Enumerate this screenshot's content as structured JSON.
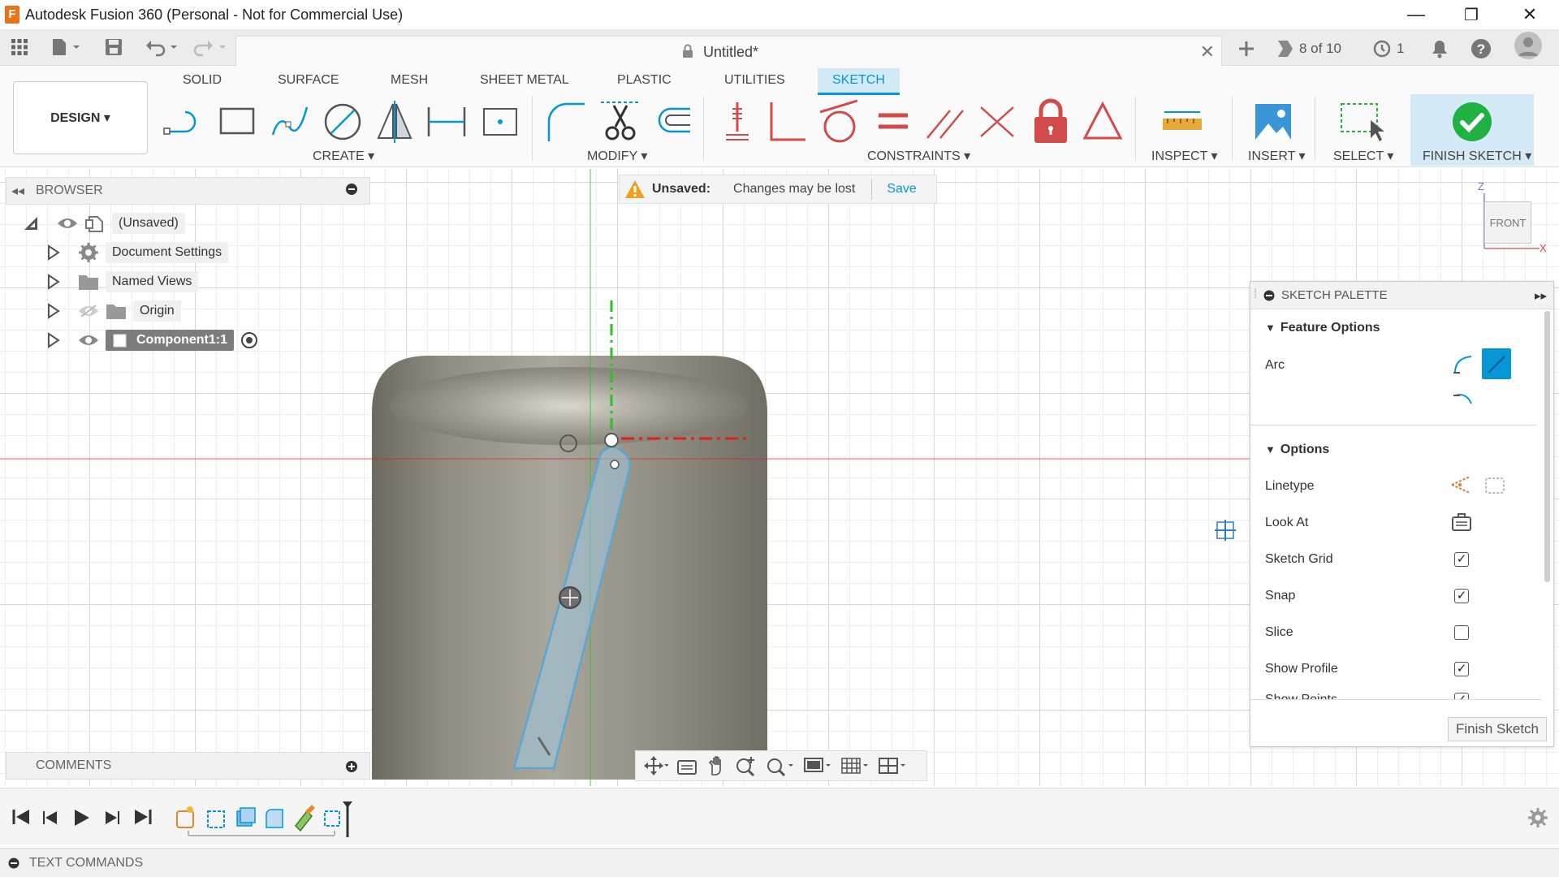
{
  "window": {
    "title": "Autodesk Fusion 360 (Personal - Not for Commercial Use)",
    "logo_letter": "F",
    "minimize": "—",
    "restore": "❐",
    "close": "✕"
  },
  "document_tab": {
    "name": "Untitled*",
    "close": "✕"
  },
  "quick_right": {
    "jobs": "8 of 10",
    "clock_count": "1"
  },
  "ribbon": {
    "tabs": [
      "SOLID",
      "SURFACE",
      "MESH",
      "SHEET METAL",
      "PLASTIC",
      "UTILITIES",
      "SKETCH"
    ],
    "active_tab": "SKETCH",
    "workspace": "DESIGN ▾",
    "groups": {
      "create": "CREATE ▾",
      "modify": "MODIFY ▾",
      "constraints": "CONSTRAINTS ▾",
      "inspect": "INSPECT ▾",
      "insert": "INSERT ▾",
      "select": "SELECT ▾",
      "finish": "FINISH SKETCH ▾"
    }
  },
  "browser": {
    "title": "BROWSER",
    "root": "(Unsaved)",
    "items": [
      "Document Settings",
      "Named Views",
      "Origin",
      "Component1:1"
    ]
  },
  "unsaved_bar": {
    "label": "Unsaved:",
    "message": "Changes may be lost",
    "save": "Save"
  },
  "viewcube": {
    "face": "FRONT",
    "z": "Z",
    "x": "X"
  },
  "palette": {
    "title": "SKETCH PALETTE",
    "feature_options": "Feature Options",
    "arc_label": "Arc",
    "options": "Options",
    "rows": [
      "Linetype",
      "Look At",
      "Sketch Grid",
      "Snap",
      "Slice",
      "Show Profile",
      "Show Points"
    ],
    "checked": {
      "sketch_grid": true,
      "snap": true,
      "slice": false,
      "show_profile": true,
      "show_points": true
    },
    "finish_button": "Finish Sketch"
  },
  "comments": {
    "title": "COMMENTS"
  },
  "text_commands": {
    "title": "TEXT COMMANDS"
  },
  "colors": {
    "accent": "#0696d7",
    "finish_bg": "#d4ebf7",
    "finish_check": "#1fb141",
    "lock_red": "#d24b4b",
    "axis_red": "#e02020",
    "axis_green": "#22c322",
    "sketch_blue": "#5aa7d3"
  }
}
